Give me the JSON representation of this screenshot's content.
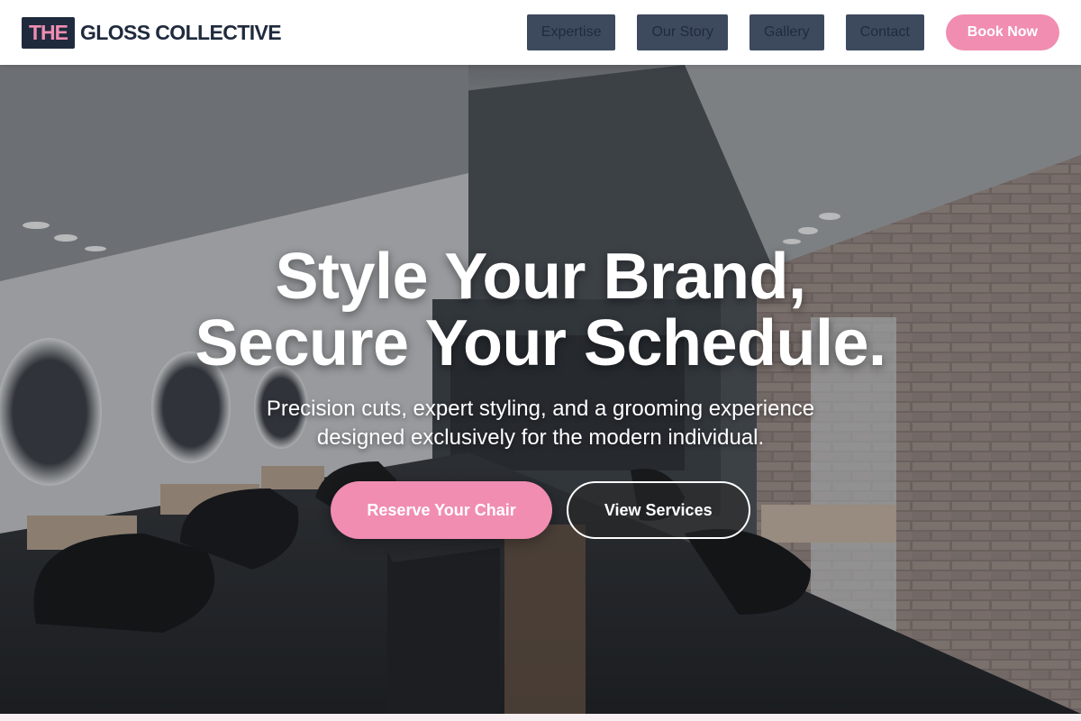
{
  "header": {
    "logo_mark": "THE",
    "logo_text": "GLOSS COLLECTIVE",
    "nav": [
      "Expertise",
      "Our Story",
      "Gallery",
      "Contact"
    ],
    "book_label": "Book Now"
  },
  "hero": {
    "title_line1": "Style Your Brand,",
    "title_line2": "Secure Your Schedule.",
    "subtitle": "Precision cuts, expert styling, and a grooming experience designed exclusively for the modern individual.",
    "primary_cta": "Reserve Your Chair",
    "secondary_cta": "View Services"
  },
  "colors": {
    "accent_pink": "#f08db1",
    "navy": "#1f2a3d",
    "nav_button": "#3d4a5e"
  }
}
